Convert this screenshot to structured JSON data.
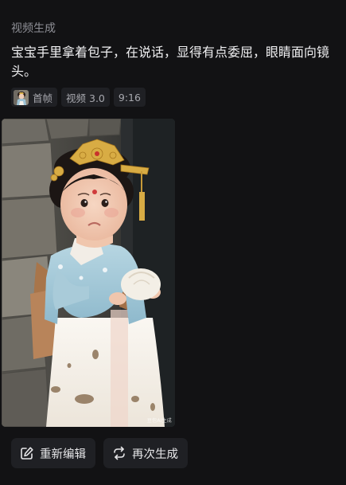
{
  "section": {
    "title": "视频生成"
  },
  "prompt": {
    "text": "宝宝手里拿着包子，在说话，显得有点委屈，眼睛面向镜头。"
  },
  "meta": {
    "first_frame_label": "首帧",
    "model_label": "视频 3.0",
    "ratio_label": "9:16"
  },
  "video": {
    "watermark": "豆包AI生成"
  },
  "actions": {
    "edit_label": "重新编辑",
    "regenerate_label": "再次生成"
  },
  "icons": {
    "edit": "edit-icon",
    "regenerate": "refresh-icon"
  }
}
